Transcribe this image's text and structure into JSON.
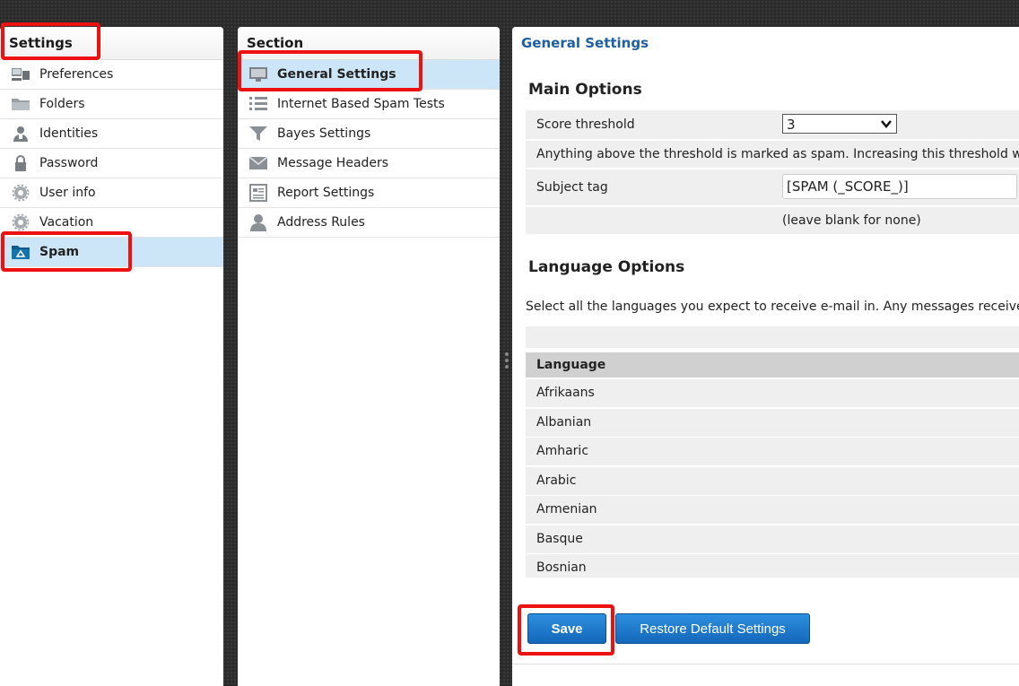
{
  "settings_panel": {
    "title": "Settings",
    "items": [
      {
        "label": "Preferences",
        "icon": "preferences-icon"
      },
      {
        "label": "Folders",
        "icon": "folder-icon"
      },
      {
        "label": "Identities",
        "icon": "identity-icon"
      },
      {
        "label": "Password",
        "icon": "lock-icon"
      },
      {
        "label": "User info",
        "icon": "gear-icon"
      },
      {
        "label": "Vacation",
        "icon": "gear-icon"
      },
      {
        "label": "Spam",
        "icon": "spam-folder-icon",
        "selected": true
      }
    ]
  },
  "section_panel": {
    "title": "Section",
    "items": [
      {
        "label": "General Settings",
        "icon": "monitor-icon",
        "selected": true
      },
      {
        "label": "Internet Based Spam Tests",
        "icon": "list-icon"
      },
      {
        "label": "Bayes Settings",
        "icon": "filter-icon"
      },
      {
        "label": "Message Headers",
        "icon": "envelope-icon"
      },
      {
        "label": "Report Settings",
        "icon": "report-icon"
      },
      {
        "label": "Address Rules",
        "icon": "person-icon"
      }
    ]
  },
  "main": {
    "title": "General Settings",
    "main_options": {
      "heading": "Main Options",
      "score_threshold_label": "Score threshold",
      "score_threshold_value": "3",
      "threshold_note": "Anything above the threshold is marked as spam. Increasing this threshold w",
      "subject_tag_label": "Subject tag",
      "subject_tag_value": "[SPAM (_SCORE_)]",
      "subject_tag_hint": "(leave blank for none)"
    },
    "language_options": {
      "heading": "Language Options",
      "description": "Select all the languages you expect to receive e-mail in. Any messages receivec",
      "column_header": "Language",
      "languages": [
        "Afrikaans",
        "Albanian",
        "Amharic",
        "Arabic",
        "Armenian",
        "Basque",
        "Bosnian"
      ]
    },
    "buttons": {
      "save": "Save",
      "restore": "Restore Default Settings"
    }
  },
  "colors": {
    "selected_row": "#cde6f7",
    "highlight_border": "#ee1111",
    "button_blue": "#1f7ad0",
    "title_blue": "#1f5fa0"
  }
}
